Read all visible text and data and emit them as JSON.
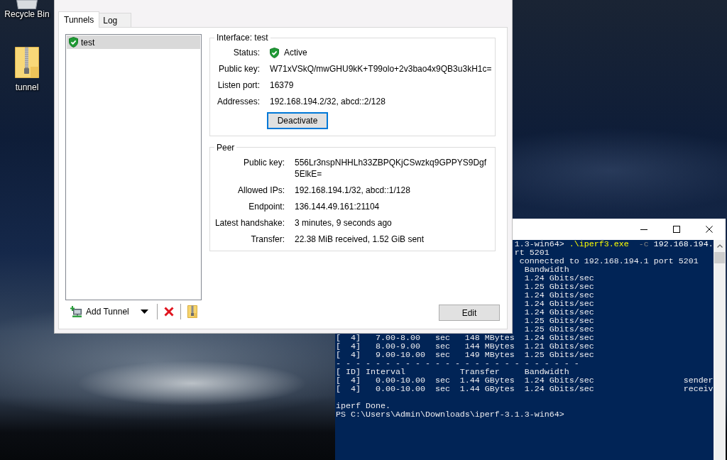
{
  "desktop": {
    "icons": [
      {
        "kind": "recycle_bin",
        "label": "Recycle Bin"
      },
      {
        "kind": "zip_folder",
        "label": "tunnel"
      }
    ]
  },
  "tunnel_manager": {
    "tabs": [
      {
        "label": "Tunnels",
        "selected": true
      },
      {
        "label": "Log",
        "selected": false
      }
    ],
    "tunnels": [
      {
        "name": "test",
        "selected": true
      }
    ],
    "toolbar": {
      "add_tunnel": "Add Tunnel"
    },
    "interface": {
      "title": "Interface: test",
      "status": {
        "label": "Status:",
        "value": "Active"
      },
      "fields": [
        {
          "label": "Public key:",
          "value": "W71xVSkQ/mwGHU9kK+T99olo+2v3bao4x9QB3u3kH1c="
        },
        {
          "label": "Listen port:",
          "value": "16379"
        },
        {
          "label": "Addresses:",
          "value": "192.168.194.2/32, abcd::2/128"
        }
      ],
      "button": "Deactivate"
    },
    "peer": {
      "title": "Peer",
      "fields": [
        {
          "label": "Public key:",
          "value": "556Lr3nspNHHLh33ZBPQKjCSwzkq9GPPYS9Dgf5ElkE="
        },
        {
          "label": "Allowed IPs:",
          "value": "192.168.194.1/32, abcd::1/128"
        },
        {
          "label": "Endpoint:",
          "value": "136.144.49.161:21104"
        },
        {
          "label": "Latest handshake:",
          "value": "3 minutes, 9 seconds ago"
        },
        {
          "label": "Transfer:",
          "value": "22.38 MiB received, 1.52 GiB sent"
        }
      ]
    },
    "edit_button": "Edit"
  },
  "terminal": {
    "cut_lines": [
      {
        "parts": [
          {
            "kind": "prompt",
            "text": "1.3-win64> "
          },
          {
            "kind": "command",
            "text": ".\\iperf3.exe"
          },
          {
            "kind": "parameter",
            "text": "  -c"
          },
          {
            "kind": "argument",
            "text": " 192.168.194."
          }
        ]
      },
      {
        "text": "rt 5201"
      },
      {
        "text": " connected to 192.168.194.1 port 5201"
      },
      {
        "text": "  Bandwidth"
      },
      {
        "text": "  1.24 Gbits/sec"
      },
      {
        "text": "  1.25 Gbits/sec"
      },
      {
        "text": "  1.24 Gbits/sec"
      },
      {
        "text": "  1.24 Gbits/sec"
      },
      {
        "text": "  1.24 Gbits/sec"
      },
      {
        "text": "  1.25 Gbits/sec"
      },
      {
        "text": "  1.25 Gbits/sec"
      }
    ],
    "blocks": [
      [
        "[  4]   7.00-8.00   sec   148 MBytes  1.24 Gbits/sec",
        "[  4]   8.00-9.00   sec   144 MBytes  1.21 Gbits/sec",
        "[  4]   9.00-10.00  sec   149 MBytes  1.25 Gbits/sec",
        "- - - - - - - - - - - - - - - - - - - - - - - - -",
        "[ ID] Interval           Transfer     Bandwidth",
        "[  4]   0.00-10.00  sec  1.44 GBytes  1.24 Gbits/sec                  sender",
        "[  4]   0.00-10.00  sec  1.44 GBytes  1.24 Gbits/sec                  receiv"
      ],
      [
        "iperf Done.",
        "PS C:\\Users\\Admin\\Downloads\\iperf-3.1.3-win64>"
      ]
    ]
  }
}
